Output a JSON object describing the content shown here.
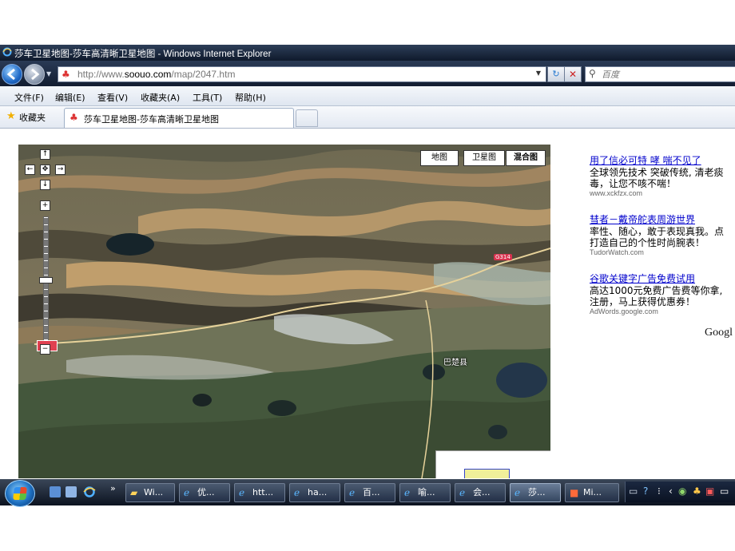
{
  "window": {
    "title": "莎车卫星地图-莎车高清晰卫星地图 - Windows Internet Explorer"
  },
  "nav": {
    "url_prefix": "http://www.",
    "url_domain": "soouo.com",
    "url_path": "/map/2047.htm",
    "search_placeholder": "百度"
  },
  "menu": {
    "items": [
      "文件(F)",
      "编辑(E)",
      "查看(V)",
      "收藏夹(A)",
      "工具(T)",
      "帮助(H)"
    ]
  },
  "favorites": {
    "label": "收藏夹",
    "tab_title": "莎车卫星地图-莎车高清晰卫星地图"
  },
  "map": {
    "types": [
      "地图",
      "卫星图",
      "混合图"
    ],
    "active_type": "混合图",
    "labels": {
      "town": "巴楚县",
      "road": "G314"
    },
    "controls": {
      "up": "↑",
      "left": "←",
      "center": "✥",
      "right": "→",
      "down": "↓",
      "zoom_in": "+",
      "zoom_out": "−"
    }
  },
  "ads": [
    {
      "headline": "用了信必可特 哮 喘不见了",
      "body1": "全球领先技术 突破传统, 清老痰",
      "body2": "毒，让您不咳不喘！",
      "url": "www.xckfzx.com"
    },
    {
      "headline": "彗者－戴帝舵表周游世界",
      "body1": "率性、随心，敢于表现真我。点",
      "body2": "打造自己的个性时尚腕表！",
      "url": "TudorWatch.com"
    },
    {
      "headline": "谷歌关键字广告免费试用",
      "body1": "高达1000元免费广告费等你拿,",
      "body2": "注册，马上获得优惠券！",
      "url": "AdWords.google.com"
    }
  ],
  "google_label": "Googl",
  "taskbar": {
    "more": "»",
    "tasks": [
      {
        "label": "Wi...",
        "icon": "folder-icon"
      },
      {
        "label": "优...",
        "icon": "ie-icon"
      },
      {
        "label": "htt...",
        "icon": "ie-icon"
      },
      {
        "label": "ha...",
        "icon": "ie-icon"
      },
      {
        "label": "百...",
        "icon": "ie-icon"
      },
      {
        "label": "喻...",
        "icon": "ie-icon"
      },
      {
        "label": "会...",
        "icon": "ie-icon"
      },
      {
        "label": "莎...",
        "icon": "ie-icon"
      },
      {
        "label": "Mi...",
        "icon": "powerpoint-icon"
      }
    ]
  },
  "colors": {
    "titlebar": "#1a2840",
    "link": "#0000cc",
    "road_badge": "#d8334f"
  }
}
